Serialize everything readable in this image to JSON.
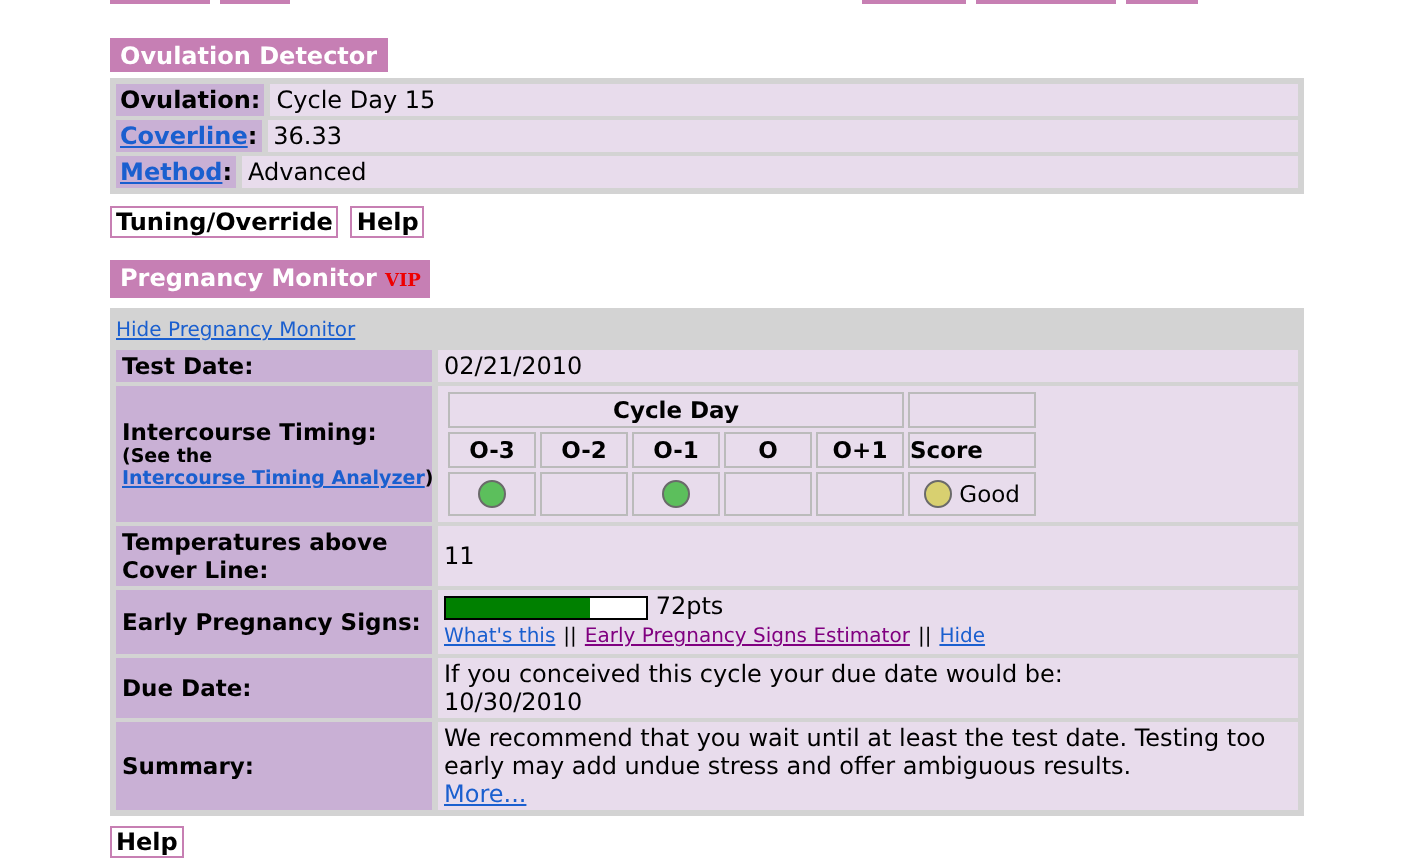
{
  "ovulation_detector": {
    "title": "Ovulation Detector",
    "rows": [
      {
        "label": "Ovulation",
        "link": false,
        "suffix": ":",
        "value": "Cycle Day 15"
      },
      {
        "label": "Coverline",
        "link": true,
        "suffix": ":",
        "value": "36.33"
      },
      {
        "label": "Method",
        "link": true,
        "suffix": ":",
        "value": "Advanced"
      }
    ],
    "buttons": [
      "Tuning/Override",
      "Help"
    ]
  },
  "pregnancy_monitor": {
    "title": "Pregnancy Monitor",
    "badge": "VIP",
    "hide_link": "Hide Pregnancy Monitor",
    "test_date": {
      "label": "Test Date:",
      "value": "02/21/2010"
    },
    "intercourse_timing": {
      "label": "Intercourse Timing:",
      "note_prefix": "(See the ",
      "note_link": "Intercourse Timing Analyzer",
      "note_suffix": ")",
      "group_header": "Cycle Day",
      "score_header": "Score",
      "days": [
        {
          "day": "O-3",
          "dot": true,
          "color": "#5cbf5c"
        },
        {
          "day": "O-2",
          "dot": false
        },
        {
          "day": "O-1",
          "dot": true,
          "color": "#5cbf5c"
        },
        {
          "day": "O",
          "dot": false
        },
        {
          "day": "O+1",
          "dot": false
        }
      ],
      "score": {
        "label": "Good",
        "color": "#d8d070"
      }
    },
    "temperatures": {
      "label": "Temperatures above Cover Line:",
      "value": "11"
    },
    "early_signs": {
      "label": "Early Pregnancy Signs:",
      "level": 0.72,
      "points": "72pts",
      "links": [
        {
          "text": "What's this",
          "visited": false
        },
        {
          "text": "Early Pregnancy Signs Estimator",
          "visited": true
        },
        {
          "text": "Hide",
          "visited": false
        }
      ],
      "separator": "||"
    },
    "due_date": {
      "label": "Due Date:",
      "text": "If you conceived this cycle your due date would be:",
      "date": "10/30/2010"
    },
    "summary": {
      "label": "Summary:",
      "text": "We recommend that you wait until at least the test date. Testing too early may add undue stress and offer ambiguous results.",
      "link": "More..."
    }
  },
  "footer_button": "Help"
}
